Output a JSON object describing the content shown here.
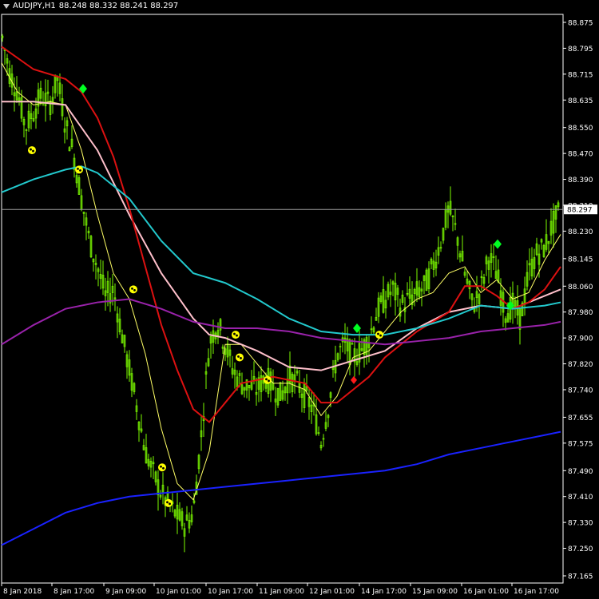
{
  "header": {
    "symbol": "AUDJPY,H1",
    "ohlc": "88.248 88.332 88.241 88.297"
  },
  "colors": {
    "background": "#000000",
    "axis": "#ffffff",
    "candles": "#7CFC00",
    "price_line": "#9a9a9a",
    "price_label_bg": "#ffffff",
    "price_label_text": "#000000"
  },
  "chart_data": {
    "type": "line",
    "title": "",
    "y_ticks": [
      "88.875",
      "88.795",
      "88.715",
      "88.635",
      "88.550",
      "88.470",
      "88.390",
      "88.310",
      "88.230",
      "88.145",
      "88.060",
      "87.980",
      "87.900",
      "87.820",
      "87.740",
      "87.655",
      "87.575",
      "87.490",
      "87.410",
      "87.330",
      "87.250",
      "87.165"
    ],
    "ylim": [
      87.165,
      88.875
    ],
    "x_ticks": [
      "8 Jan 2018",
      "8 Jan 17:00",
      "9 Jan 09:00",
      "10 Jan 01:00",
      "10 Jan 17:00",
      "11 Jan 09:00",
      "12 Jan 01:00",
      "14 Jan 17:00",
      "15 Jan 09:00",
      "16 Jan 01:00",
      "16 Jan 17:00"
    ],
    "current_price": "88.297",
    "price_series": {
      "name": "",
      "x": [
        0,
        10,
        20,
        30,
        40,
        50,
        60,
        70,
        80,
        90,
        100,
        110,
        120,
        130,
        140,
        150,
        160,
        170,
        180,
        190,
        200,
        210,
        220,
        230,
        240,
        250,
        260,
        270,
        280,
        290,
        300,
        310,
        320,
        330,
        340,
        350,
        360,
        370,
        380,
        390,
        400,
        410,
        420,
        430,
        440,
        450,
        460,
        470,
        480,
        490,
        500,
        510,
        520,
        530,
        540,
        550,
        560,
        570,
        580,
        590,
        600,
        610,
        620,
        630,
        640,
        650,
        660,
        670,
        680,
        690,
        700
      ],
      "y": [
        88.84,
        88.72,
        88.66,
        88.55,
        88.6,
        88.65,
        88.62,
        88.7,
        88.56,
        88.47,
        88.33,
        88.2,
        88.12,
        88.03,
        88.05,
        87.92,
        87.8,
        87.68,
        87.55,
        87.48,
        87.42,
        87.38,
        87.35,
        87.32,
        87.36,
        87.6,
        87.88,
        87.95,
        87.88,
        87.8,
        87.76,
        87.75,
        87.74,
        87.78,
        87.75,
        87.72,
        87.78,
        87.76,
        87.72,
        87.68,
        87.58,
        87.7,
        87.85,
        87.88,
        87.84,
        87.86,
        87.9,
        87.98,
        88.02,
        88.05,
        88.0,
        88.02,
        88.04,
        88.06,
        88.12,
        88.2,
        88.3,
        88.22,
        88.1,
        88.0,
        88.05,
        88.15,
        88.1,
        87.98,
        88.0,
        87.96,
        88.1,
        88.16,
        88.18,
        88.25,
        88.3
      ]
    },
    "series": [
      {
        "name": "",
        "color": "#ffff66",
        "x": [
          0,
          20,
          40,
          60,
          80,
          100,
          120,
          140,
          160,
          180,
          200,
          220,
          240,
          260,
          280,
          300,
          320,
          340,
          360,
          380,
          400,
          420,
          440,
          460,
          480,
          500,
          520,
          540,
          560,
          580,
          600,
          620,
          640,
          660,
          680,
          700
        ],
        "y": [
          88.75,
          88.66,
          88.62,
          88.63,
          88.62,
          88.48,
          88.28,
          88.1,
          88.02,
          87.85,
          87.62,
          87.45,
          87.4,
          87.55,
          87.88,
          87.88,
          87.82,
          87.76,
          87.76,
          87.74,
          87.66,
          87.72,
          87.84,
          87.86,
          87.92,
          87.98,
          88.02,
          88.04,
          88.1,
          88.12,
          88.04,
          88.08,
          88.02,
          88.04,
          88.14,
          88.22
        ]
      },
      {
        "name": "",
        "color": "#ffc0cb",
        "x": [
          0,
          40,
          80,
          120,
          160,
          200,
          240,
          260,
          280,
          320,
          360,
          400,
          440,
          480,
          520,
          560,
          600,
          640,
          680,
          700
        ],
        "y": [
          88.63,
          88.63,
          88.62,
          88.48,
          88.28,
          88.1,
          87.96,
          87.91,
          87.9,
          87.86,
          87.81,
          87.8,
          87.83,
          87.86,
          87.93,
          87.98,
          88.0,
          87.99,
          88.03,
          88.05
        ]
      },
      {
        "name": "",
        "color": "#dd1111",
        "x": [
          0,
          40,
          80,
          100,
          120,
          140,
          160,
          180,
          200,
          220,
          240,
          260,
          280,
          300,
          340,
          380,
          400,
          420,
          440,
          460,
          480,
          500,
          520,
          560,
          580,
          600,
          620,
          640,
          660,
          680,
          700
        ],
        "y": [
          88.8,
          88.73,
          88.7,
          88.66,
          88.58,
          88.46,
          88.3,
          88.12,
          87.94,
          87.8,
          87.68,
          87.64,
          87.7,
          87.76,
          87.78,
          87.76,
          87.7,
          87.7,
          87.74,
          87.78,
          87.84,
          87.88,
          87.92,
          87.98,
          88.06,
          88.06,
          88.03,
          87.99,
          88.01,
          88.05,
          88.12
        ]
      },
      {
        "name": "",
        "color": "#22c8cc",
        "x": [
          0,
          40,
          80,
          100,
          120,
          160,
          200,
          240,
          280,
          320,
          360,
          400,
          440,
          480,
          520,
          560,
          600,
          640,
          680,
          700
        ],
        "y": [
          88.35,
          88.39,
          88.42,
          88.43,
          88.41,
          88.33,
          88.2,
          88.1,
          88.07,
          88.02,
          87.96,
          87.92,
          87.91,
          87.91,
          87.93,
          87.96,
          88.0,
          87.99,
          88.0,
          88.01
        ]
      },
      {
        "name": "",
        "color": "#9922aa",
        "x": [
          0,
          40,
          80,
          120,
          160,
          200,
          240,
          280,
          320,
          360,
          400,
          440,
          480,
          520,
          560,
          600,
          640,
          680,
          700
        ],
        "y": [
          87.88,
          87.94,
          87.99,
          88.01,
          88.02,
          87.99,
          87.95,
          87.93,
          87.93,
          87.92,
          87.9,
          87.89,
          87.88,
          87.89,
          87.9,
          87.92,
          87.93,
          87.94,
          87.95
        ]
      },
      {
        "name": "",
        "color": "#1a22ff",
        "x": [
          0,
          40,
          80,
          120,
          160,
          200,
          240,
          280,
          320,
          360,
          400,
          440,
          480,
          520,
          560,
          600,
          640,
          680,
          700
        ],
        "y": [
          87.26,
          87.31,
          87.36,
          87.39,
          87.41,
          87.42,
          87.43,
          87.44,
          87.45,
          87.46,
          87.47,
          87.48,
          87.49,
          87.51,
          87.54,
          87.56,
          87.58,
          87.6,
          87.61
        ]
      }
    ],
    "buy_markers": [
      {
        "x": 102,
        "y": 88.67
      },
      {
        "x": 445,
        "y": 87.93
      },
      {
        "x": 621,
        "y": 88.19
      },
      {
        "x": 637,
        "y": 88.0
      }
    ],
    "sell_markers": [
      {
        "x": 441,
        "y": 87.77
      }
    ],
    "fractal_markers": [
      {
        "x": 38,
        "y": 88.48
      },
      {
        "x": 97,
        "y": 88.42
      },
      {
        "x": 165,
        "y": 88.05
      },
      {
        "x": 201,
        "y": 87.5
      },
      {
        "x": 209,
        "y": 87.39
      },
      {
        "x": 293,
        "y": 87.91
      },
      {
        "x": 298,
        "y": 87.84
      },
      {
        "x": 333,
        "y": 87.77
      },
      {
        "x": 473,
        "y": 87.91
      }
    ],
    "grid": false,
    "legend": "none"
  }
}
